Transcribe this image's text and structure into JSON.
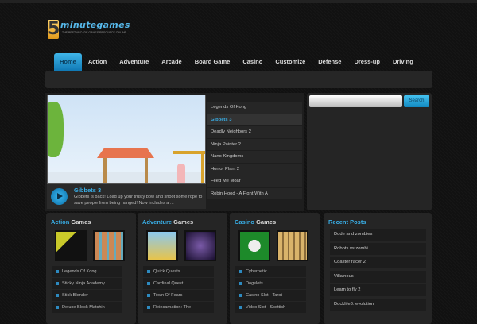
{
  "logo": {
    "digit": "5",
    "name": "minutegames",
    "tagline": "THE BEST ARCADE GAMES RESOURCE ONLINE"
  },
  "nav": [
    "Home",
    "Action",
    "Adventure",
    "Arcade",
    "Board Game",
    "Casino",
    "Customize",
    "Defense",
    "Dress-up",
    "Driving"
  ],
  "featured": {
    "title": "Gibbets 3",
    "description": "Gibbets is back! Load up your trusty bow and shoot some rope to save people from being hanged! Now includes a ...",
    "list": [
      "Legends Of Kong",
      "Gibbets 3",
      "Deadly Neighbors 2",
      "Ninja Painter 2",
      "Nano Kingdoms",
      "Horror Plant 2",
      "Feed Me Moar",
      "Robin Hood - A Fight With A"
    ],
    "active_index": 1
  },
  "search": {
    "placeholder": "",
    "button": "Search"
  },
  "columns": [
    {
      "highlight": "Action",
      "rest": " Games",
      "items": [
        "Legends Of Kong",
        "Sticky Ninja Academy",
        "Stick Blender",
        "Deluxe Block Matchin"
      ]
    },
    {
      "highlight": "Adventure",
      "rest": " Games",
      "items": [
        "Quick Quests",
        "Cardinal Quest",
        "Town Of Fears",
        "Reincarnation: The"
      ]
    },
    {
      "highlight": "Casino",
      "rest": " Games",
      "items": [
        "Cybernetic",
        "Dogslots",
        "Casino Slot - Tarot",
        "Video Slot - Scottish"
      ]
    }
  ],
  "recent_posts": {
    "title": "Recent Posts",
    "items": [
      "Dude and zombies",
      "Robots vs zombi",
      "Coaster racer 2",
      "Villainous",
      "Learn to fly 2",
      "Ducklife3: evolution"
    ]
  },
  "colors": {
    "accent": "#39aee6",
    "bg": "#141414",
    "panel": "#252525"
  }
}
